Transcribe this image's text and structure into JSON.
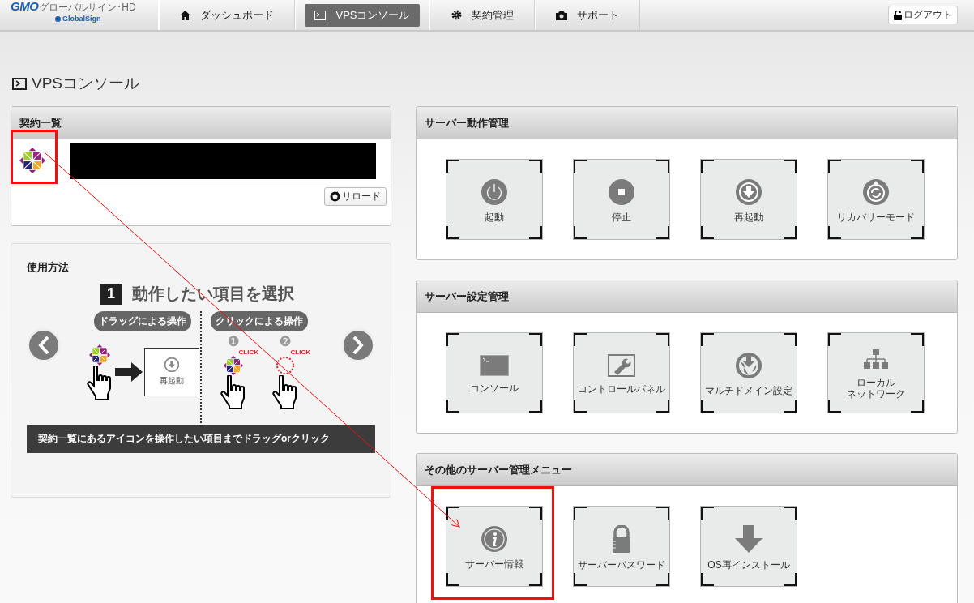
{
  "header": {
    "logo": {
      "brand": "GMO",
      "name": "グローバルサイン･HD",
      "sub": "GlobalSign"
    },
    "nav": [
      {
        "label": "ダッシュボード",
        "selected": false
      },
      {
        "label": "VPSコンソール",
        "selected": true
      },
      {
        "label": "契約管理",
        "selected": false
      },
      {
        "label": "サポート",
        "selected": false
      }
    ],
    "logout": "ログアウト"
  },
  "page_title": "VPSコンソール",
  "contracts": {
    "title": "契約一覧",
    "reload": "リロード"
  },
  "usage": {
    "title": "使用方法",
    "step": "1",
    "step_title": "動作したい項目を選択",
    "methods": [
      {
        "label": "ドラッグによる操作",
        "kind": "drag",
        "tile": "再起動"
      },
      {
        "label": "クリックによる操作",
        "kind": "click",
        "steps": [
          {
            "number": "❶",
            "mark": "CLICK"
          },
          {
            "number": "❷",
            "mark": "CLICK"
          }
        ]
      }
    ],
    "caption": "契約一覧にあるアイコンを操作したい項目までドラッグorクリック"
  },
  "sections": [
    {
      "title": "サーバー動作管理",
      "tiles": [
        {
          "lines": [
            "起動"
          ]
        },
        {
          "lines": [
            "停止"
          ]
        },
        {
          "lines": [
            "再起動"
          ]
        },
        {
          "lines": [
            "リカバリーモード"
          ]
        }
      ]
    },
    {
      "title": "サーバー設定管理",
      "tiles": [
        {
          "lines": [
            "コンソール"
          ]
        },
        {
          "lines": [
            "コントロールパネル"
          ]
        },
        {
          "lines": [
            "マルチドメイン設定"
          ]
        },
        {
          "lines": [
            "ローカル",
            "ネットワーク"
          ]
        }
      ]
    },
    {
      "title": "その他のサーバー管理メニュー",
      "tiles": [
        {
          "lines": [
            "サーバー情報"
          ]
        },
        {
          "lines": [
            "サーバーパスワード"
          ]
        },
        {
          "lines": [
            "OS再インストール"
          ]
        }
      ]
    }
  ]
}
